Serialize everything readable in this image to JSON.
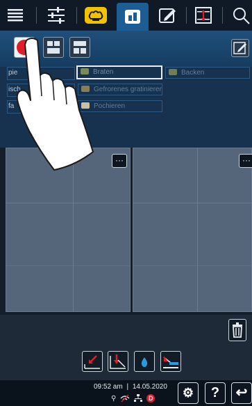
{
  "colors": {
    "accent_blue": "#1c5d94",
    "header_blue": "#1f4f7a",
    "panel_grey": "#55657a",
    "alert_red": "#e11d2a",
    "selection_white": "#e8eef4"
  },
  "topbar": {
    "icons": [
      "menu-icon",
      "sliders-icon",
      "chef-hat-icon",
      "dashboard-icon",
      "edit-icon",
      "sort-icon",
      "search-icon"
    ],
    "active": "dashboard-icon"
  },
  "workhead": {
    "view_buttons": [
      "record-view",
      "grid-view",
      "split-view"
    ],
    "edit_icon": "edit-icon"
  },
  "programs": {
    "left_labels": [
      "pie",
      "isch",
      "fa"
    ],
    "items": [
      {
        "name": "Braten",
        "icon": "roast-icon",
        "selected": true
      },
      {
        "name": "Gefrorenes gratinieren",
        "icon": "gratin-icon",
        "selected": false
      },
      {
        "name": "Pochieren",
        "icon": "poach-icon",
        "selected": false
      },
      {
        "name": "Backen",
        "icon": "bake-icon",
        "selected": false
      }
    ]
  },
  "panels": [
    {
      "name": "left-cooking-panel",
      "menu_label": "···"
    },
    {
      "name": "right-cooking-panel",
      "menu_label": "···"
    }
  ],
  "actions": [
    "steam-in-icon",
    "steam-out-icon",
    "water-drop-icon",
    "heat-icon"
  ],
  "status": {
    "time": "09:52 am",
    "separator": "|",
    "date": "14.05.2020",
    "badge": "D",
    "settings_label": "⚙",
    "help_label": "?",
    "back_label": "↩"
  }
}
